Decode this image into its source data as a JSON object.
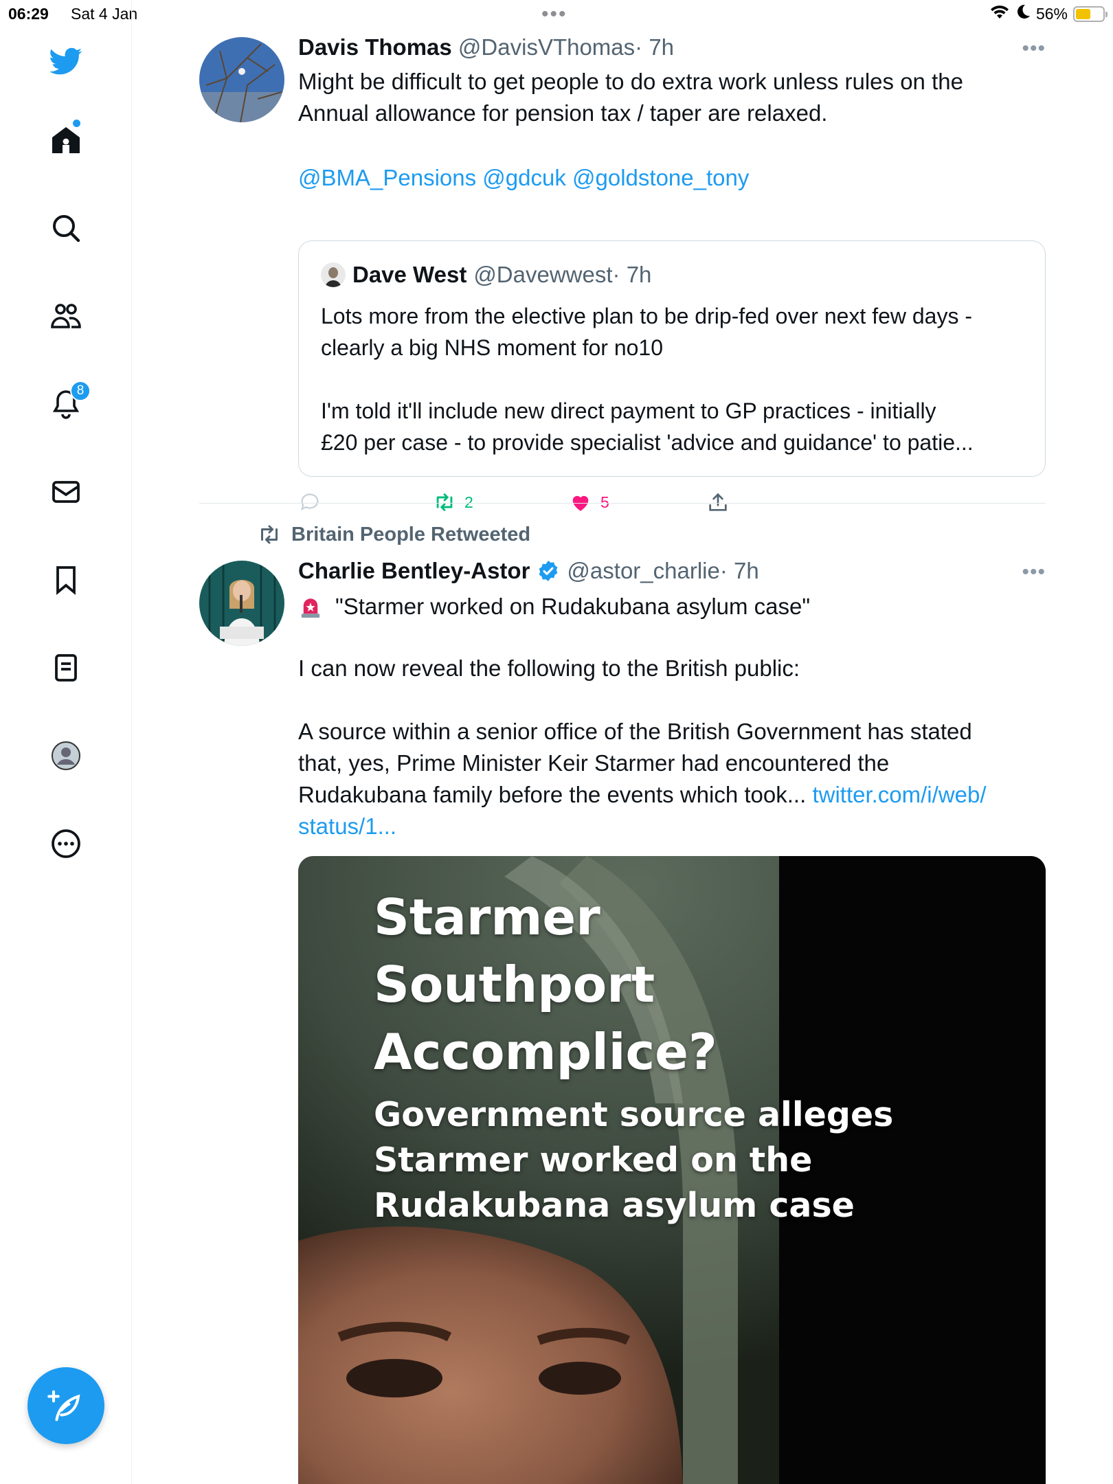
{
  "status_bar": {
    "time": "06:29",
    "date": "Sat 4 Jan",
    "battery_pct": "56%",
    "battery_level": 0.56
  },
  "sidebar": {
    "items": [
      {
        "icon": "twitter-bird-icon"
      },
      {
        "icon": "home-icon"
      },
      {
        "icon": "search-icon"
      },
      {
        "icon": "communities-icon"
      },
      {
        "icon": "notifications-bell-icon",
        "badge": "8"
      },
      {
        "icon": "messages-envelope-icon"
      },
      {
        "icon": "bookmark-icon"
      },
      {
        "icon": "lists-icon"
      },
      {
        "icon": "profile-icon"
      },
      {
        "icon": "more-circle-icon"
      }
    ],
    "compose_icon": "compose-feather-icon"
  },
  "tweet1": {
    "name": "Davis Thomas",
    "handle": "@DavisVThomas",
    "time": "· 7h",
    "text": "Might be difficult to get people to do extra work unless rules on the\nAnnual allowance for pension tax / taper are relaxed.",
    "mentions": "@BMA_Pensions @gdcuk @goldstone_tony",
    "quote": {
      "name": "Dave West",
      "handle": "@Davewwest",
      "time": "· 7h",
      "text": "Lots more from the elective plan to be drip-fed over next few days -\nclearly a big NHS moment for no10\n\nI'm told it'll include new direct payment to GP practices - initially\n£20 per case - to provide specialist 'advice and guidance' to patie..."
    },
    "retweets": "2",
    "likes": "5"
  },
  "tweet2": {
    "retweeted_by": "Britain People Retweeted",
    "name": "Charlie Bentley-Astor",
    "handle": "@astor_charlie",
    "time": "· 7h",
    "headline": "\"Starmer worked on Rudakubana asylum case\"",
    "body": "I can now reveal the following to the British public:\n\nA source within a senior office of the British Government has stated\nthat, yes, Prime Minister Keir Starmer had encountered the\nRudakubana family before the events which took... ",
    "link_part1": "twitter.com/i/web/",
    "link_part2": "status/1...",
    "media": {
      "title": "Starmer\nSouthport\nAccomplice?",
      "subtitle": "Government source alleges\nStarmer worked on the\nRudakubana asylum case"
    }
  },
  "colors": {
    "accent": "#1d9bf0",
    "retweet_green": "#00ba7c",
    "like_pink": "#f91880",
    "secondary_text": "#536471"
  }
}
